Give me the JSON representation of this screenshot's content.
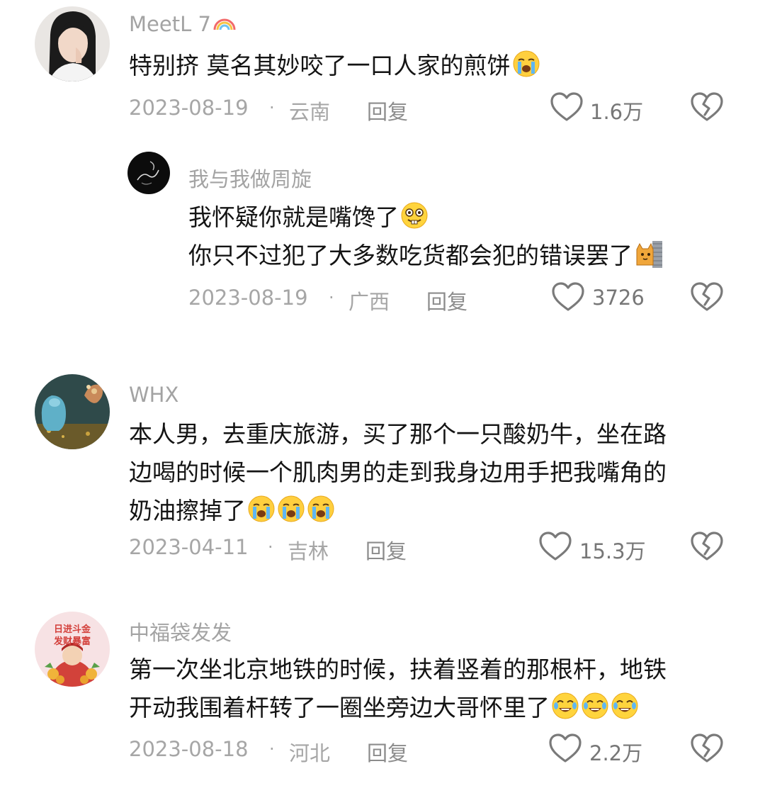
{
  "colors": {
    "meta": "#a6a6a6",
    "text": "#141414",
    "icon": "#7a7a7a"
  },
  "icons": {
    "like": "heart-outline",
    "dislike": "broken-heart-outline",
    "emoji_cry": "loudly-crying-face",
    "emoji_grin": "buck-tooth-face",
    "emoji_laugh": "tears-of-joy-face",
    "cat": "cat-peek"
  },
  "c1": {
    "user": "MeetL 7",
    "lines": [
      "特别挤 莫名其妙咬了一口人家的煎饼"
    ],
    "date": "2023-08-19",
    "sep": "·",
    "region": "云南",
    "reply": "回复",
    "likes": "1.6万"
  },
  "c2": {
    "user": "我与我做周旋",
    "lines": [
      "我怀疑你就是嘴馋了",
      "你只不过犯了大多数吃货都会犯的错误罢了"
    ],
    "date": "2023-08-19",
    "sep": "·",
    "region": "广西",
    "reply": "回复",
    "likes": "3726"
  },
  "c3": {
    "user": "WHX",
    "lines": [
      "本人男，去重庆旅游，买了那个一只酸奶牛，坐在路",
      "边喝的时候一个肌肉男的走到我身边用手把我嘴角的",
      "奶油擦掉了"
    ],
    "date": "2023-04-11",
    "sep": "·",
    "region": "吉林",
    "reply": "回复",
    "likes": "15.3万"
  },
  "c4": {
    "user": "中福袋发发",
    "avatar_text": [
      "日进斗金",
      "发财暴富"
    ],
    "lines": [
      "第一次坐北京地铁的时候，扶着竖着的那根杆，地铁",
      "开动我围着杆转了一圈坐旁边大哥怀里了"
    ],
    "date": "2023-08-18",
    "sep": "·",
    "region": "河北",
    "reply": "回复",
    "likes": "2.2万"
  }
}
